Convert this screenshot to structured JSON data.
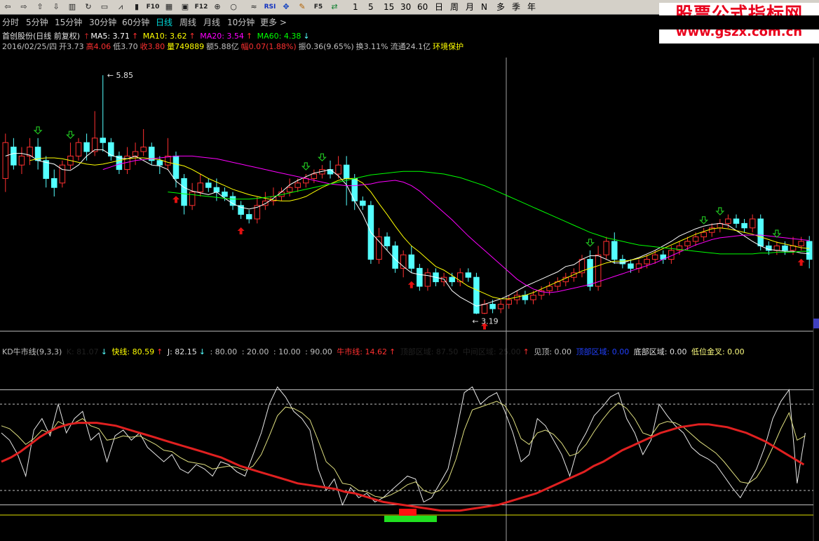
{
  "toolbar": {
    "icons": [
      "back-icon",
      "forward-icon",
      "up-icon",
      "down-icon",
      "kline-icon",
      "refresh-icon",
      "bar-chart-icon",
      "line-chart-icon",
      "candle-icon",
      "f10-icon",
      "table-icon",
      "f11-icon",
      "f12-icon",
      "f13-icon",
      "circle-icon",
      "sep",
      "wave-icon",
      "rsi-icon",
      "move-icon",
      "pen-icon",
      "f5-icon",
      "switch-icon"
    ],
    "f10": "F10",
    "f12": "F12",
    "rsi": "RSI",
    "f5": "F5",
    "periods": [
      "1",
      "5",
      "15",
      "30",
      "60"
    ],
    "period_buttons": [
      "日",
      "周",
      "月",
      "N",
      "多",
      "季",
      "年"
    ]
  },
  "watermark": {
    "line1": "股票公式指标网",
    "line2": "www.gszx.com.cn"
  },
  "nav": {
    "tabs": [
      "分时",
      "5分钟",
      "15分钟",
      "30分钟",
      "60分钟",
      "日线",
      "周线",
      "月线",
      "10分钟",
      "更多 >"
    ],
    "active": "日线"
  },
  "info": {
    "stock": "首创股份(日线 前复权)",
    "ma5": "MA5: 3.71",
    "ma10": "MA10: 3.62",
    "ma20": "MA20: 3.54",
    "ma60": "MA60: 4.38",
    "date": "2016/02/25/四",
    "open": "开3.73",
    "high": "高4.06",
    "low": "低3.70",
    "close": "收3.80",
    "volume": "量749889",
    "amount": "额5.88亿",
    "range": "幅0.07(1.88%)",
    "amplitude": "振0.36(9.65%)",
    "turnover": "换3.11%",
    "float": "流通24.1亿",
    "sector": "环境保护"
  },
  "indicator": {
    "name": "KD牛市线(9,3,3)",
    "k": "K: 81.07",
    "fast": "快线: 80.59",
    "j": "J: 82.15",
    "l80": ": 80.00",
    "l20": ": 20.00",
    "l10": ": 10.00",
    "l90": ": 90.00",
    "bull": "牛市线: 14.62",
    "top_zone": "顶部区域: 87.50",
    "mid_zone": "中间区域: 25.00",
    "top_signal": "见顶: 0.00",
    "top_area": "顶部区域: 0.00",
    "bottom_area": "底部区域: 0.00",
    "golden": "低位金叉: 0.00"
  },
  "colors": {
    "up": "#ff3030",
    "down": "#54ffff",
    "ma5": "#ffffff",
    "ma10": "#ffff00",
    "ma20": "#ff00ff",
    "ma60": "#00ff00",
    "bull": "#e02020",
    "signal_up": "#e01010",
    "signal_down": "#20c020"
  },
  "chart_data": {
    "type": "candlestick",
    "price_labels": {
      "high": "5.85",
      "low": "3.19"
    },
    "candles": [
      [
        4.7,
        5.1,
        4.55,
        5.2
      ],
      [
        5.05,
        4.85,
        4.8,
        5.15
      ],
      [
        4.85,
        4.95,
        4.75,
        5.05
      ],
      [
        4.95,
        5.05,
        4.85,
        5.15
      ],
      [
        5.05,
        4.9,
        4.8,
        5.15
      ],
      [
        4.9,
        4.7,
        4.6,
        4.95
      ],
      [
        4.7,
        4.6,
        4.5,
        4.8
      ],
      [
        4.65,
        4.85,
        4.6,
        4.9
      ],
      [
        4.85,
        4.95,
        4.8,
        5.1
      ],
      [
        4.95,
        5.1,
        4.9,
        5.15
      ],
      [
        5.1,
        5.0,
        4.9,
        5.2
      ],
      [
        5.0,
        5.15,
        4.95,
        5.45
      ],
      [
        5.15,
        5.1,
        5.0,
        5.85
      ],
      [
        5.1,
        4.95,
        4.9,
        5.15
      ],
      [
        4.95,
        4.8,
        4.75,
        5.0
      ],
      [
        4.8,
        4.95,
        4.75,
        5.05
      ],
      [
        4.95,
        5.0,
        4.85,
        5.1
      ],
      [
        5.0,
        5.05,
        4.95,
        5.25
      ],
      [
        5.05,
        4.9,
        4.85,
        5.1
      ],
      [
        4.9,
        4.85,
        4.75,
        4.95
      ],
      [
        4.85,
        4.95,
        4.8,
        5.15
      ],
      [
        4.95,
        4.7,
        4.6,
        5.0
      ],
      [
        4.7,
        4.4,
        4.3,
        4.75
      ],
      [
        4.4,
        4.55,
        4.35,
        4.65
      ],
      [
        4.55,
        4.65,
        4.5,
        4.75
      ],
      [
        4.65,
        4.6,
        4.55,
        4.7
      ],
      [
        4.6,
        4.55,
        4.45,
        4.7
      ],
      [
        4.55,
        4.5,
        4.45,
        4.6
      ],
      [
        4.5,
        4.4,
        4.35,
        4.55
      ],
      [
        4.4,
        4.3,
        4.25,
        4.45
      ],
      [
        4.3,
        4.25,
        4.2,
        4.35
      ],
      [
        4.25,
        4.4,
        4.2,
        4.5
      ],
      [
        4.4,
        4.45,
        4.35,
        4.55
      ],
      [
        4.45,
        4.5,
        4.4,
        4.6
      ],
      [
        4.5,
        4.55,
        4.45,
        4.6
      ],
      [
        4.55,
        4.6,
        4.5,
        4.7
      ],
      [
        4.6,
        4.65,
        4.55,
        4.7
      ],
      [
        4.65,
        4.7,
        4.6,
        4.75
      ],
      [
        4.7,
        4.75,
        4.65,
        4.8
      ],
      [
        4.75,
        4.8,
        4.7,
        4.85
      ],
      [
        4.8,
        4.75,
        4.7,
        4.9
      ],
      [
        4.75,
        4.85,
        4.7,
        4.95
      ],
      [
        4.85,
        4.7,
        4.4,
        4.95
      ],
      [
        4.7,
        4.45,
        4.35,
        4.75
      ],
      [
        4.45,
        4.4,
        4.35,
        4.5
      ],
      [
        4.4,
        3.8,
        3.75,
        4.45
      ],
      [
        3.8,
        4.05,
        3.75,
        4.15
      ],
      [
        4.05,
        3.95,
        3.9,
        4.1
      ],
      [
        3.95,
        3.7,
        3.65,
        4.0
      ],
      [
        3.7,
        3.85,
        3.6,
        3.9
      ],
      [
        3.85,
        3.7,
        3.65,
        3.95
      ],
      [
        3.7,
        3.5,
        3.45,
        3.75
      ],
      [
        3.5,
        3.65,
        3.45,
        3.7
      ],
      [
        3.65,
        3.55,
        3.5,
        3.7
      ],
      [
        3.55,
        3.6,
        3.5,
        3.65
      ],
      [
        3.6,
        3.55,
        3.5,
        3.65
      ],
      [
        3.55,
        3.65,
        3.5,
        3.7
      ],
      [
        3.65,
        3.6,
        3.55,
        3.7
      ],
      [
        3.6,
        3.2,
        3.19,
        3.65
      ],
      [
        3.2,
        3.3,
        3.19,
        3.35
      ],
      [
        3.3,
        3.25,
        3.2,
        3.35
      ],
      [
        3.25,
        3.3,
        3.2,
        3.35
      ],
      [
        3.3,
        3.35,
        3.25,
        3.4
      ],
      [
        3.35,
        3.4,
        3.3,
        3.45
      ],
      [
        3.4,
        3.35,
        3.3,
        3.45
      ],
      [
        3.35,
        3.4,
        3.3,
        3.45
      ],
      [
        3.4,
        3.45,
        3.35,
        3.5
      ],
      [
        3.45,
        3.5,
        3.4,
        3.55
      ],
      [
        3.5,
        3.55,
        3.45,
        3.6
      ],
      [
        3.55,
        3.6,
        3.5,
        3.65
      ],
      [
        3.6,
        3.65,
        3.55,
        3.7
      ],
      [
        3.65,
        3.8,
        3.6,
        3.85
      ],
      [
        3.8,
        3.5,
        3.45,
        3.9
      ],
      [
        3.5,
        3.85,
        3.45,
        3.95
      ],
      [
        3.85,
        4.0,
        3.8,
        4.05
      ],
      [
        4.0,
        3.8,
        3.75,
        4.1
      ],
      [
        3.8,
        3.75,
        3.7,
        3.85
      ],
      [
        3.75,
        3.7,
        3.65,
        3.8
      ],
      [
        3.7,
        3.75,
        3.65,
        3.8
      ],
      [
        3.75,
        3.8,
        3.7,
        3.85
      ],
      [
        3.8,
        3.85,
        3.75,
        3.9
      ],
      [
        3.85,
        3.8,
        3.75,
        3.9
      ],
      [
        3.8,
        3.9,
        3.75,
        3.95
      ],
      [
        3.9,
        3.95,
        3.85,
        4.0
      ],
      [
        3.95,
        4.0,
        3.9,
        4.05
      ],
      [
        4.0,
        4.05,
        3.95,
        4.1
      ],
      [
        4.05,
        4.1,
        4.0,
        4.15
      ],
      [
        4.1,
        4.15,
        4.05,
        4.2
      ],
      [
        4.15,
        4.2,
        4.1,
        4.25
      ],
      [
        4.2,
        4.25,
        4.15,
        4.3
      ],
      [
        4.25,
        4.2,
        4.15,
        4.3
      ],
      [
        4.2,
        4.15,
        4.1,
        4.25
      ],
      [
        4.15,
        4.25,
        4.1,
        4.3
      ],
      [
        4.25,
        3.95,
        3.9,
        4.3
      ],
      [
        3.95,
        3.9,
        3.85,
        4.0
      ],
      [
        3.9,
        3.95,
        3.85,
        4.0
      ],
      [
        3.95,
        3.9,
        3.85,
        4.0
      ],
      [
        3.9,
        3.95,
        3.85,
        4.05
      ],
      [
        3.95,
        4.0,
        3.9,
        4.05
      ],
      [
        4.0,
        3.8,
        3.7,
        4.06
      ]
    ],
    "ma_series": {
      "ma5": [
        4.95,
        4.98,
        4.98,
        4.96,
        4.9,
        4.88,
        4.86,
        4.8,
        4.79,
        4.85,
        4.95,
        5.02,
        5.02,
        4.96,
        4.93,
        4.92,
        4.95,
        4.9,
        4.85,
        4.84,
        4.8,
        4.67,
        4.6,
        4.56,
        4.54,
        4.52,
        4.55,
        4.48,
        4.42,
        4.38,
        4.36,
        4.38,
        4.42,
        4.48,
        4.55,
        4.63,
        4.68,
        4.72,
        4.76,
        4.78,
        4.8,
        4.73,
        4.63,
        4.45,
        4.3,
        4.1,
        4.0,
        3.9,
        3.8,
        3.72,
        3.65,
        3.63,
        3.62,
        3.6,
        3.58,
        3.45,
        3.38,
        3.33,
        3.28,
        3.3,
        3.33,
        3.36,
        3.4,
        3.45,
        3.5,
        3.54,
        3.58,
        3.62,
        3.66,
        3.72,
        3.74,
        3.8,
        3.84,
        3.84,
        3.8,
        3.76,
        3.76,
        3.79,
        3.82,
        3.86,
        3.9,
        3.95,
        4.0,
        4.06,
        4.1,
        4.14,
        4.17,
        4.19,
        4.2,
        4.18,
        4.12,
        4.06,
        4.0,
        3.95,
        3.91,
        3.9,
        3.89,
        3.89,
        3.87,
        3.86
      ],
      "ma10": [
        4.9,
        4.92,
        4.93,
        4.93,
        4.92,
        4.9,
        4.88,
        4.86,
        4.85,
        4.86,
        4.88,
        4.9,
        4.92,
        4.93,
        4.93,
        4.92,
        4.91,
        4.88,
        4.86,
        4.84,
        4.8,
        4.75,
        4.7,
        4.66,
        4.62,
        4.58,
        4.55,
        4.52,
        4.5,
        4.48,
        4.46,
        4.45,
        4.45,
        4.47,
        4.5,
        4.55,
        4.6,
        4.64,
        4.68,
        4.7,
        4.7,
        4.65,
        4.55,
        4.42,
        4.3,
        4.17,
        4.05,
        3.95,
        3.88,
        3.8,
        3.72,
        3.68,
        3.62,
        3.56,
        3.5,
        3.46,
        3.42,
        3.38,
        3.36,
        3.36,
        3.38,
        3.4,
        3.43,
        3.47,
        3.51,
        3.55,
        3.59,
        3.63,
        3.67,
        3.7,
        3.73,
        3.76,
        3.78,
        3.78,
        3.79,
        3.81,
        3.84,
        3.88,
        3.92,
        3.96,
        4.0,
        4.04,
        4.08,
        4.11,
        4.14,
        4.15,
        4.14,
        4.12,
        4.1,
        4.08,
        4.05,
        4.02,
        3.99,
        3.97,
        3.95,
        3.93,
        3.92
      ],
      "ma20": [
        4.8,
        4.83,
        4.86,
        4.88,
        4.9,
        4.91,
        4.92,
        4.93,
        4.94,
        4.95,
        4.95,
        4.95,
        4.94,
        4.93,
        4.92,
        4.9,
        4.88,
        4.86,
        4.84,
        4.82,
        4.8,
        4.78,
        4.76,
        4.74,
        4.72,
        4.7,
        4.68,
        4.66,
        4.64,
        4.63,
        4.62,
        4.62,
        4.63,
        4.64,
        4.66,
        4.67,
        4.68,
        4.66,
        4.62,
        4.56,
        4.48,
        4.4,
        4.32,
        4.24,
        4.15,
        4.06,
        3.98,
        3.9,
        3.82,
        3.74,
        3.66,
        3.58,
        3.52,
        3.47,
        3.44,
        3.43,
        3.44,
        3.46,
        3.48,
        3.5,
        3.52,
        3.55,
        3.58,
        3.61,
        3.64,
        3.67,
        3.7,
        3.73,
        3.76,
        3.8,
        3.84,
        3.88,
        3.92,
        3.96,
        3.99,
        4.02,
        4.04,
        4.05,
        4.06,
        4.07,
        4.07,
        4.07,
        4.06,
        4.05,
        4.04,
        4.03,
        4.02,
        4.01
      ],
      "ma60": [
        4.55,
        4.54,
        4.53,
        4.52,
        4.51,
        4.5,
        4.49,
        4.48,
        4.47,
        4.47,
        4.47,
        4.48,
        4.49,
        4.5,
        4.52,
        4.54,
        4.56,
        4.58,
        4.6,
        4.62,
        4.64,
        4.66,
        4.68,
        4.7,
        4.72,
        4.74,
        4.75,
        4.76,
        4.77,
        4.78,
        4.78,
        4.78,
        4.77,
        4.76,
        4.75,
        4.73,
        4.71,
        4.68,
        4.65,
        4.62,
        4.58,
        4.54,
        4.5,
        4.46,
        4.42,
        4.38,
        4.34,
        4.3,
        4.26,
        4.22,
        4.18,
        4.14,
        4.1,
        4.07,
        4.04,
        4.02,
        4.0,
        3.98,
        3.96,
        3.95,
        3.94,
        3.93,
        3.92,
        3.91,
        3.9,
        3.89,
        3.88,
        3.87,
        3.86,
        3.86,
        3.86,
        3.86,
        3.86,
        3.87,
        3.87,
        3.88,
        3.88,
        3.88,
        3.89,
        3.89
      ]
    },
    "kd_series": {
      "white": [
        60,
        55,
        45,
        30,
        62,
        70,
        58,
        80,
        60,
        70,
        75,
        55,
        60,
        40,
        58,
        62,
        55,
        60,
        50,
        45,
        40,
        45,
        35,
        32,
        38,
        35,
        30,
        40,
        38,
        33,
        30,
        45,
        60,
        80,
        92,
        85,
        75,
        70,
        62,
        35,
        20,
        28,
        10,
        22,
        15,
        18,
        12,
        15,
        20,
        25,
        30,
        28,
        12,
        15,
        25,
        35,
        60,
        88,
        92,
        80,
        85,
        88,
        75,
        60,
        40,
        45,
        70,
        65,
        55,
        45,
        30,
        50,
        60,
        72,
        78,
        85,
        88,
        70,
        60,
        45,
        55,
        80,
        72,
        65,
        60,
        50,
        45,
        42,
        38,
        30,
        22,
        15,
        25,
        35,
        50,
        70,
        82,
        90,
        25,
        60
      ],
      "yellow": [
        65,
        63,
        58,
        52,
        56,
        62,
        60,
        68,
        65,
        67,
        70,
        65,
        63,
        55,
        56,
        58,
        57,
        58,
        55,
        52,
        48,
        47,
        43,
        40,
        39,
        38,
        35,
        36,
        37,
        36,
        34,
        37,
        45,
        58,
        72,
        78,
        77,
        74,
        69,
        55,
        40,
        35,
        25,
        24,
        20,
        19,
        16,
        15,
        17,
        20,
        24,
        26,
        20,
        18,
        20,
        27,
        42,
        62,
        76,
        78,
        80,
        82,
        79,
        70,
        56,
        52,
        60,
        62,
        59,
        53,
        44,
        46,
        52,
        61,
        69,
        76,
        81,
        77,
        70,
        60,
        58,
        66,
        68,
        67,
        64,
        59,
        54,
        50,
        46,
        40,
        33,
        26,
        25,
        29,
        38,
        50,
        63,
        74,
        55,
        58
      ],
      "bull": [
        40,
        43,
        47,
        52,
        57,
        61,
        64,
        66,
        67,
        67,
        67,
        66,
        65,
        63,
        61,
        59,
        57,
        55,
        53,
        51,
        49,
        47,
        45,
        43,
        40,
        37,
        35,
        33,
        31,
        29,
        27,
        25,
        24,
        23,
        22,
        21,
        19,
        18,
        16,
        14,
        12,
        11,
        10,
        9,
        8,
        7,
        6,
        6,
        6,
        7,
        8,
        9,
        10,
        12,
        14,
        16,
        18,
        21,
        24,
        27,
        30,
        33,
        37,
        40,
        44,
        48,
        51,
        54,
        57,
        60,
        62,
        64,
        65,
        66,
        66,
        65,
        64,
        62,
        60,
        57,
        54,
        50,
        46,
        42,
        38
      ]
    }
  }
}
